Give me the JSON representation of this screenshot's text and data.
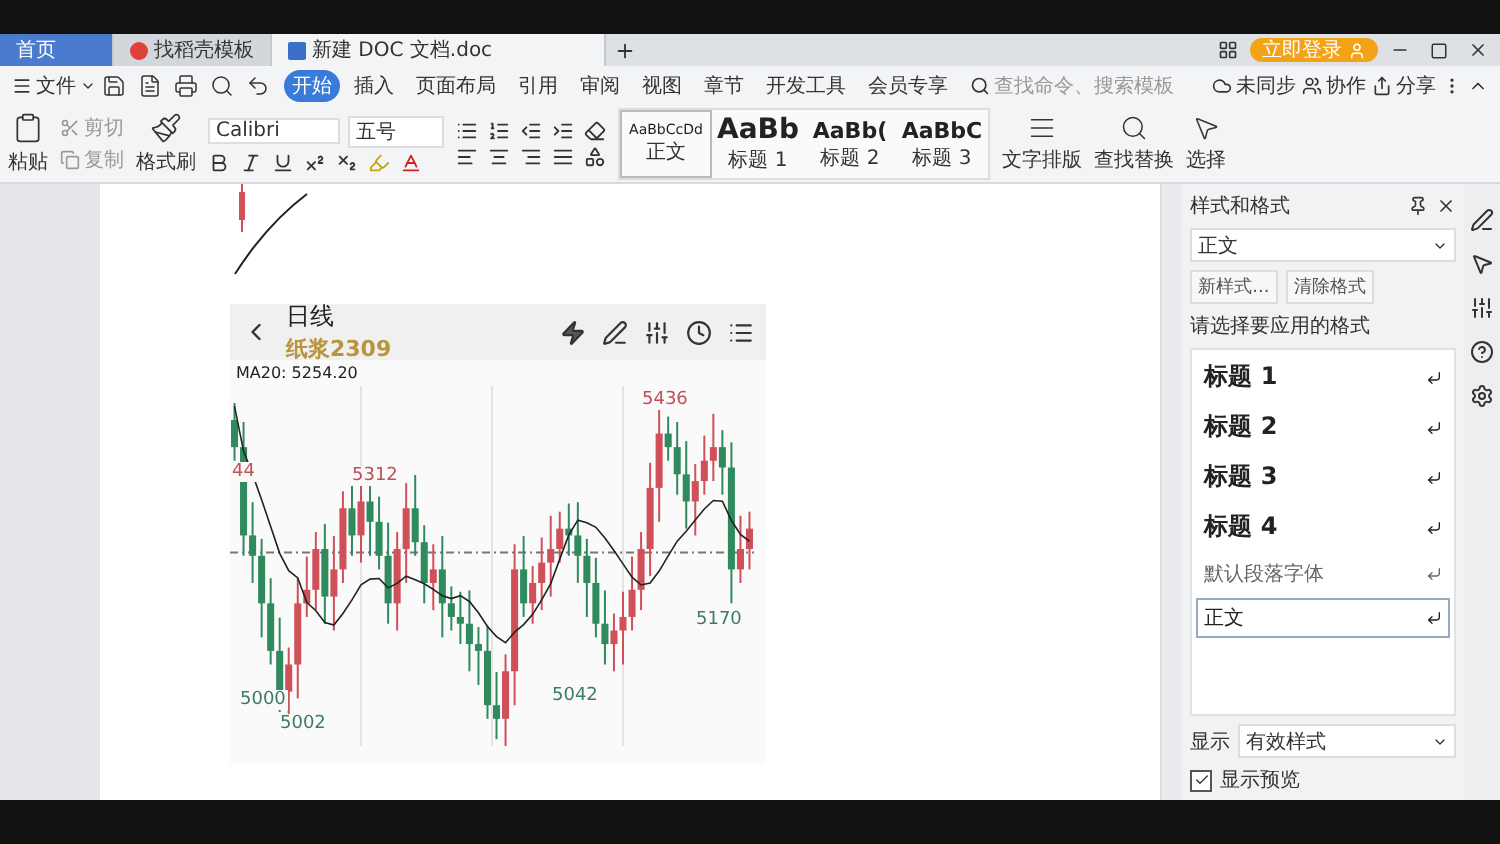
{
  "tabs": [
    {
      "label": "首页",
      "kind": "home",
      "selected": false
    },
    {
      "label": "找稻壳模板",
      "kind": "docer",
      "selected": false
    },
    {
      "label": "新建 DOC 文档.doc",
      "kind": "doc",
      "selected": true
    }
  ],
  "login_button": "立即登录",
  "menu": {
    "file": "文件",
    "items": [
      {
        "label": "开始",
        "selected": true
      },
      {
        "label": "插入",
        "selected": false
      },
      {
        "label": "页面布局",
        "selected": false
      },
      {
        "label": "引用",
        "selected": false
      },
      {
        "label": "审阅",
        "selected": false
      },
      {
        "label": "视图",
        "selected": false
      },
      {
        "label": "章节",
        "selected": false
      },
      {
        "label": "开发工具",
        "selected": false
      },
      {
        "label": "会员专享",
        "selected": false
      }
    ],
    "search": {
      "placeholder": "查找命令、搜索模板"
    },
    "actions": [
      "未同步",
      "协作",
      "分享"
    ]
  },
  "ribbon": {
    "paste": "粘贴",
    "cut": "剪切",
    "copy": "复制",
    "format_painter": "格式刷",
    "font": "Calibri",
    "size": "五号",
    "styles": [
      {
        "preview": "AaBbCcDd",
        "name": "正文",
        "selected": true
      },
      {
        "preview": "AaBb",
        "name": "标题 1",
        "selected": false
      },
      {
        "preview": "AaBb(",
        "name": "标题 2",
        "selected": false
      },
      {
        "preview": "AaBbC",
        "name": "标题 3",
        "selected": false
      }
    ],
    "text_layout": "文字排版",
    "find_replace": "查找替换",
    "select": "选择"
  },
  "chart_card": {
    "title": "日线",
    "symbol": "纸浆2309",
    "ma": "MA20: 5254.20",
    "labels": [
      {
        "text": "5436",
        "kind": "high"
      },
      {
        "text": "44",
        "kind": "high"
      },
      {
        "text": "5312",
        "kind": "high"
      },
      {
        "text": "5170",
        "kind": "low"
      },
      {
        "text": "5042",
        "kind": "low"
      },
      {
        "text": "5000",
        "kind": "low"
      },
      {
        "text": "5002",
        "kind": "low"
      }
    ]
  },
  "styles_panel": {
    "title": "样式和格式",
    "current": "正文",
    "buttons": [
      "新样式...",
      "清除格式"
    ],
    "prompt": "请选择要应用的格式",
    "items": [
      {
        "label": "标题 1",
        "kind": "heading",
        "selected": false
      },
      {
        "label": "标题 2",
        "kind": "heading",
        "selected": false
      },
      {
        "label": "标题 3",
        "kind": "heading",
        "selected": false
      },
      {
        "label": "标题 4",
        "kind": "heading",
        "selected": false
      },
      {
        "label": "默认段落字体",
        "kind": "char",
        "selected": false
      },
      {
        "label": "正文",
        "kind": "para",
        "selected": true
      }
    ],
    "show_label": "显示",
    "show_value": "有效样式",
    "preview": {
      "label": "显示预览",
      "checked": true
    }
  }
}
